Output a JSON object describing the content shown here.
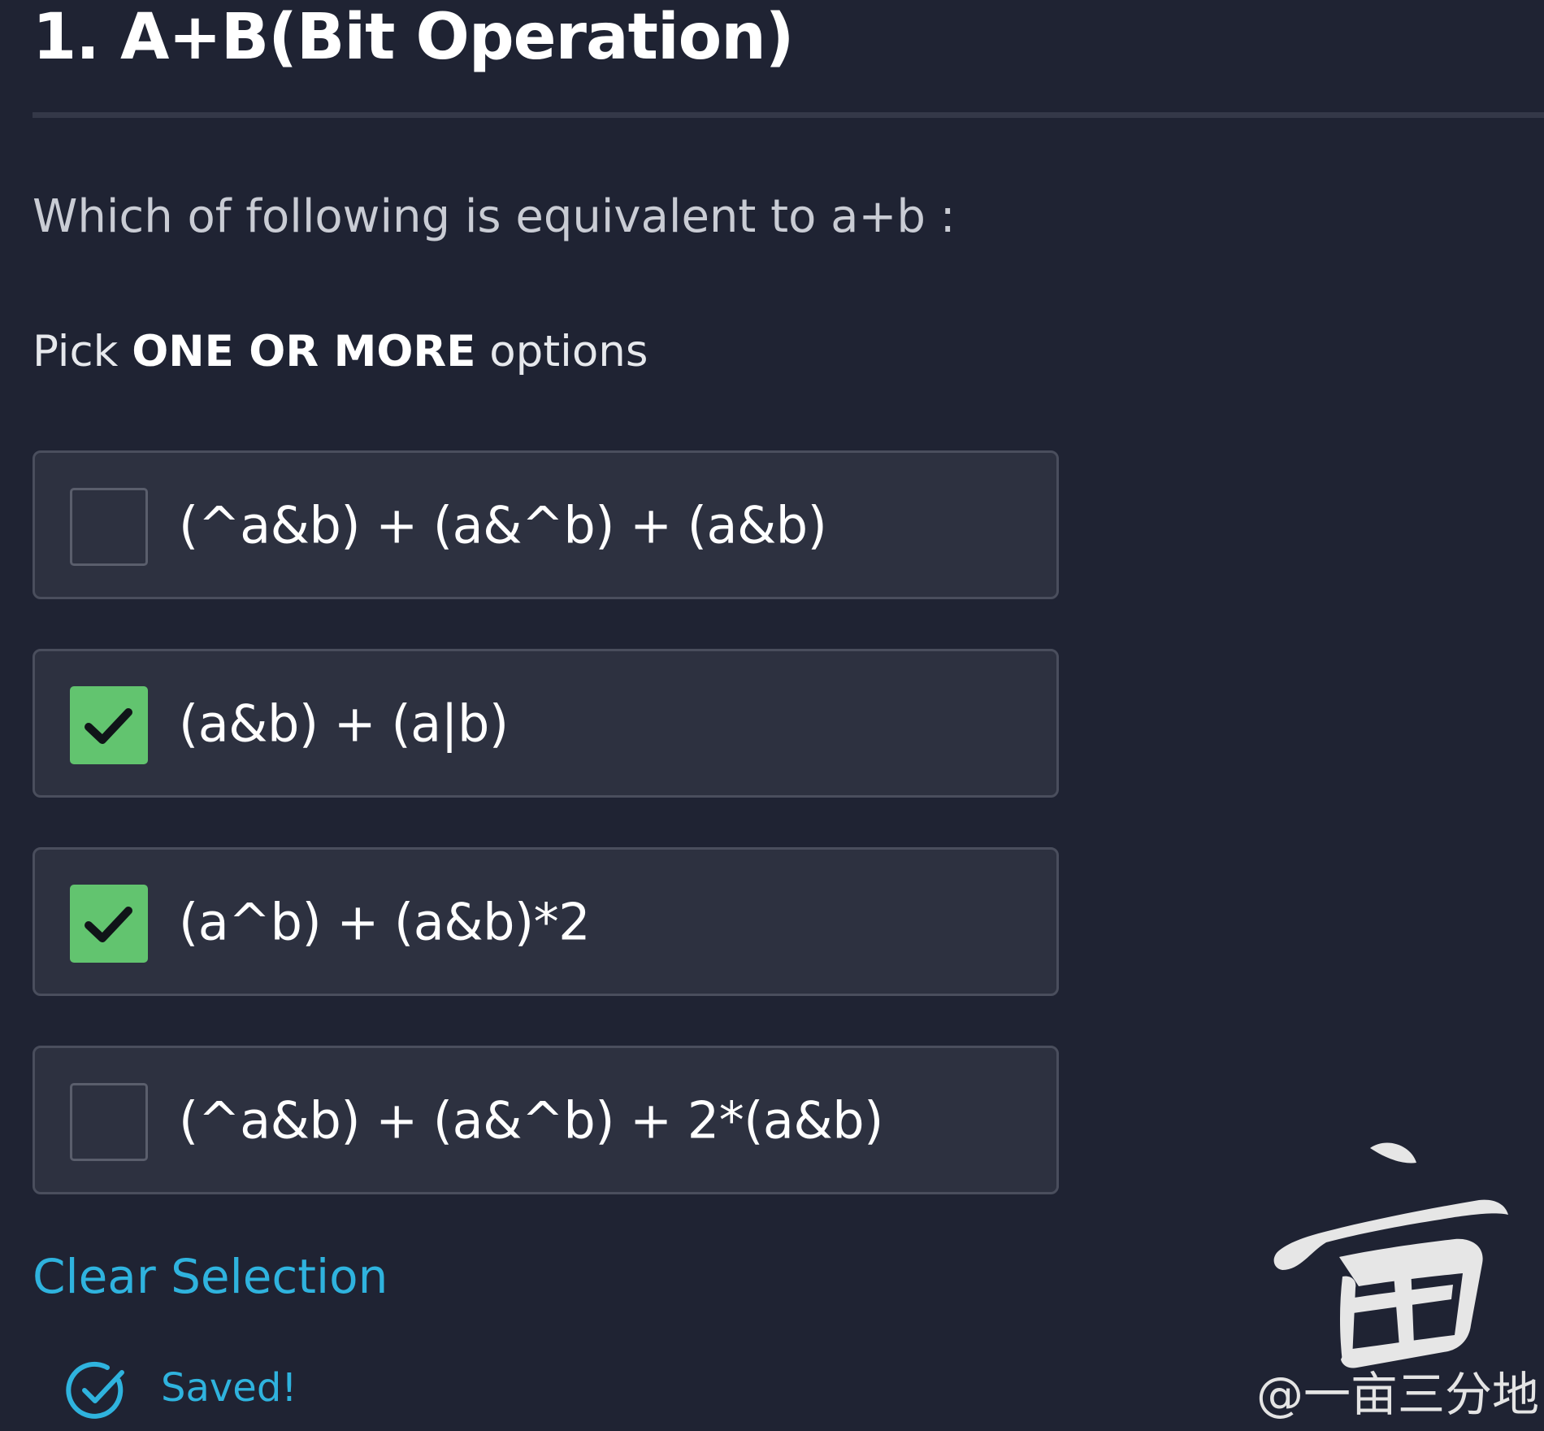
{
  "question": {
    "title": "1. A+B(Bit Operation)",
    "prompt": "Which of following is equivalent to a+b :",
    "instruction_prefix": "Pick ",
    "instruction_emphasis": "ONE OR MORE",
    "instruction_suffix": " options"
  },
  "options": [
    {
      "label": "(^a&b) + (a&^b) + (a&b)",
      "checked": false
    },
    {
      "label": "(a&b) + (a|b)",
      "checked": true
    },
    {
      "label": "(a^b) + (a&b)*2",
      "checked": true
    },
    {
      "label": "(^a&b) + (a&^b) + 2*(a&b)",
      "checked": false
    }
  ],
  "actions": {
    "clear_label": "Clear Selection"
  },
  "status": {
    "saved_label": "Saved!",
    "icon": "check-circle-icon"
  },
  "watermark": {
    "logo_char": "亩",
    "text": "@一亩三分地"
  },
  "colors": {
    "background": "#1f2333",
    "option_bg": "#2d3140",
    "checked": "#62c46f",
    "link": "#2fb3de"
  }
}
